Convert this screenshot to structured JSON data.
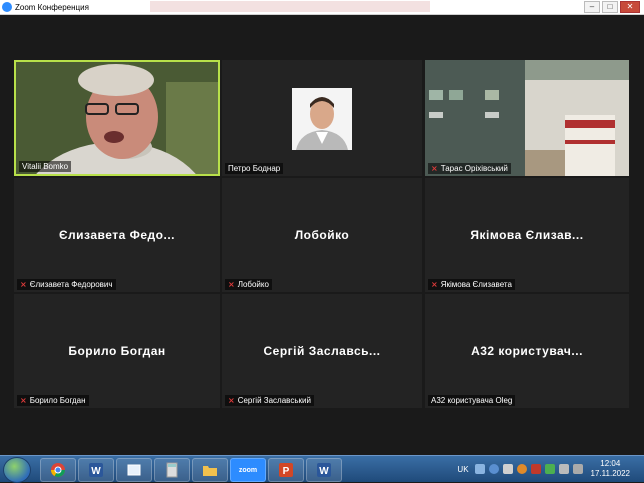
{
  "window": {
    "title": "Zoom Конференция"
  },
  "tiles": [
    {
      "name": "Vitalii Bomko",
      "center": "",
      "muted": false
    },
    {
      "name": "Петро Боднар",
      "center": "",
      "muted": false
    },
    {
      "name": "Тарас Оріхівський",
      "center": "",
      "muted": true
    },
    {
      "name": "Єлизавета Федорович",
      "center": "Єлизавета Федо...",
      "muted": true
    },
    {
      "name": "Лобойко",
      "center": "Лобойко",
      "muted": true
    },
    {
      "name": "Якімова Єлизавета",
      "center": "Якімова Єлизав...",
      "muted": true
    },
    {
      "name": "Борило Богдан",
      "center": "Борило Богдан",
      "muted": true
    },
    {
      "name": "Сергій Заславський",
      "center": "Сергій Заславсь...",
      "muted": true
    },
    {
      "name": "А32 користувача Oleg",
      "center": "А32 користувач...",
      "muted": false
    }
  ],
  "taskbar": {
    "zoom_label": "zoom",
    "lang": "UK",
    "time": "12:04",
    "date": "17.11.2022"
  }
}
